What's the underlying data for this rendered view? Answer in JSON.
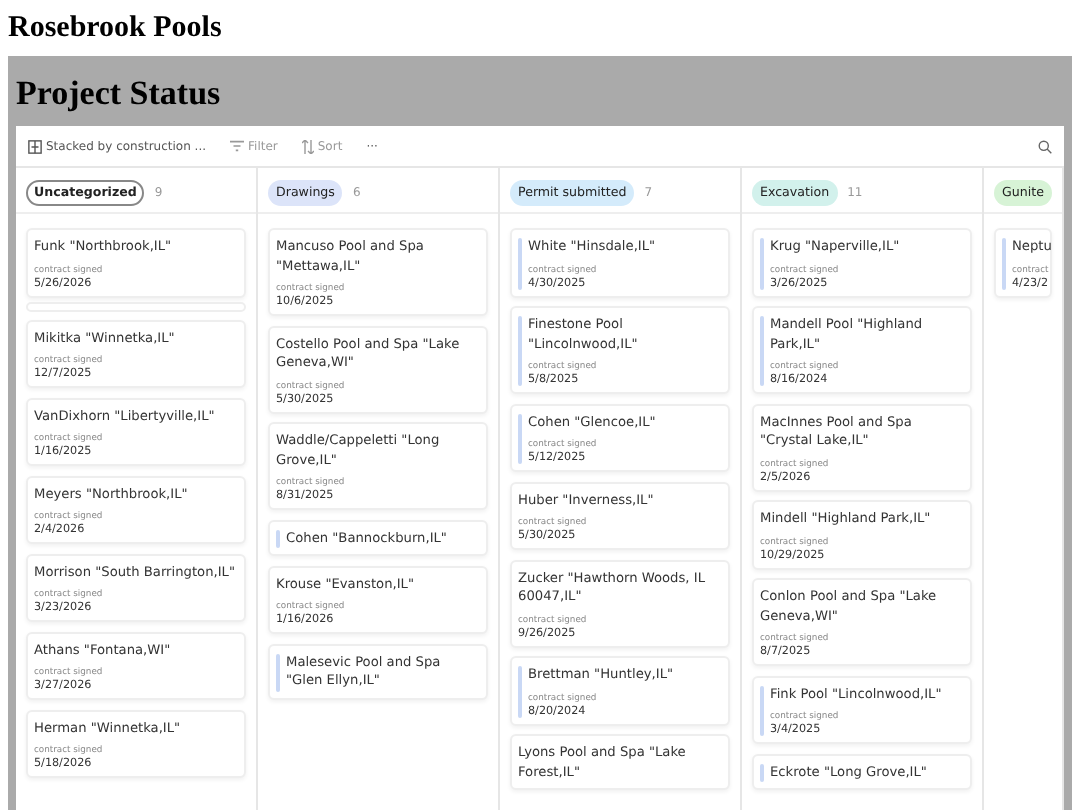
{
  "site_title": "Rosebrook Pools",
  "panel_title": "Project Status",
  "toolbar": {
    "group_by": "Stacked by construction ...",
    "filter": "Filter",
    "sort": "Sort",
    "more": "···"
  },
  "columns": [
    {
      "tag": "Uncategorized",
      "kind": "outline",
      "color": "#ffffff",
      "count": "9",
      "cards": [
        {
          "kind": "card",
          "accent": false,
          "title": "Funk \"Northbrook,IL\"",
          "label": "contract signed",
          "date": "5/26/2026"
        },
        {
          "kind": "blank"
        },
        {
          "kind": "card",
          "accent": false,
          "title": "Mikitka \"Winnetka,IL\"",
          "label": "contract signed",
          "date": "12/7/2025"
        },
        {
          "kind": "card",
          "accent": false,
          "title": "VanDixhorn \"Libertyville,IL\"",
          "label": "contract signed",
          "date": "1/16/2025"
        },
        {
          "kind": "card",
          "accent": false,
          "title": "Meyers \"Northbrook,IL\"",
          "label": "contract signed",
          "date": "2/4/2026"
        },
        {
          "kind": "card",
          "accent": false,
          "title": "Morrison \"South Barrington,IL\"",
          "label": "contract signed",
          "date": "3/23/2026"
        },
        {
          "kind": "card",
          "accent": false,
          "title": "Athans \"Fontana,WI\"",
          "label": "contract signed",
          "date": "3/27/2026"
        },
        {
          "kind": "card",
          "accent": false,
          "title": "Herman \"Winnetka,IL\"",
          "label": "contract signed",
          "date": "5/18/2026"
        }
      ]
    },
    {
      "tag": "Drawings",
      "kind": "filled",
      "color": "#dce4f9",
      "count": "6",
      "cards": [
        {
          "kind": "card",
          "accent": false,
          "title": "Mancuso Pool and Spa \"Mettawa,IL\"",
          "label": "contract signed",
          "date": "10/6/2025"
        },
        {
          "kind": "card",
          "accent": false,
          "title": "Costello Pool and Spa \"Lake Geneva,WI\"",
          "label": "contract signed",
          "date": "5/30/2025"
        },
        {
          "kind": "card",
          "accent": false,
          "title": "Waddle/Cappeletti \"Long Grove,IL\"",
          "label": "contract signed",
          "date": "8/31/2025"
        },
        {
          "kind": "card",
          "accent": true,
          "title": "Cohen \"Bannockburn,IL\""
        },
        {
          "kind": "card",
          "accent": false,
          "title": "Krouse \"Evanston,IL\"",
          "label": "contract signed",
          "date": "1/16/2026"
        },
        {
          "kind": "card",
          "accent": true,
          "title": "Malesevic Pool and Spa \"Glen Ellyn,IL\""
        }
      ]
    },
    {
      "tag": "Permit submitted",
      "kind": "filled",
      "color": "#d4ebfb",
      "count": "7",
      "cards": [
        {
          "kind": "card",
          "accent": true,
          "title": "White \"Hinsdale,IL\"",
          "label": "contract signed",
          "date": "4/30/2025"
        },
        {
          "kind": "card",
          "accent": true,
          "title": "Finestone Pool \"Lincolnwood,IL\"",
          "label": "contract signed",
          "date": "5/8/2025"
        },
        {
          "kind": "card",
          "accent": true,
          "title": "Cohen \"Glencoe,IL\"",
          "label": "contract signed",
          "date": "5/12/2025"
        },
        {
          "kind": "card",
          "accent": false,
          "title": "Huber \"Inverness,IL\"",
          "label": "contract signed",
          "date": "5/30/2025"
        },
        {
          "kind": "card",
          "accent": false,
          "title": "Zucker \"Hawthorn Woods, IL 60047,IL\"",
          "label": "contract signed",
          "date": "9/26/2025"
        },
        {
          "kind": "card",
          "accent": true,
          "title": "Brettman \"Huntley,IL\"",
          "label": "contract signed",
          "date": "8/20/2024"
        },
        {
          "kind": "card",
          "accent": false,
          "title": "Lyons Pool and Spa \"Lake Forest,IL\""
        }
      ]
    },
    {
      "tag": "Excavation",
      "kind": "filled",
      "color": "#d2f1ec",
      "count": "11",
      "cards": [
        {
          "kind": "card",
          "accent": true,
          "title": "Krug \"Naperville,IL\"",
          "label": "contract signed",
          "date": "3/26/2025"
        },
        {
          "kind": "card",
          "accent": true,
          "title": "Mandell Pool \"Highland Park,IL\"",
          "label": "contract signed",
          "date": "8/16/2024"
        },
        {
          "kind": "card",
          "accent": false,
          "title": "MacInnes Pool and Spa \"Crystal Lake,IL\"",
          "label": "contract signed",
          "date": "2/5/2026"
        },
        {
          "kind": "card",
          "accent": false,
          "title": "Mindell \"Highland Park,IL\"",
          "label": "contract signed",
          "date": "10/29/2025"
        },
        {
          "kind": "card",
          "accent": false,
          "title": "Conlon Pool and Spa \"Lake Geneva,WI\"",
          "label": "contract signed",
          "date": "8/7/2025"
        },
        {
          "kind": "card",
          "accent": true,
          "title": "Fink Pool \"Lincolnwood,IL\"",
          "label": "contract signed",
          "date": "3/4/2025"
        },
        {
          "kind": "card",
          "accent": true,
          "title": "Eckrote \"Long Grove,IL\""
        }
      ]
    },
    {
      "tag": "Gunite",
      "kind": "filled",
      "color": "#d7f3d6",
      "cards": [
        {
          "kind": "card",
          "accent": true,
          "title": "Neptu",
          "label": "contract",
          "date": "4/23/2"
        }
      ]
    }
  ]
}
